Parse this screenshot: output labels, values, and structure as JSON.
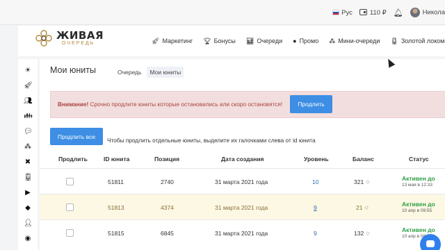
{
  "topbar": {
    "language": "Рус",
    "balance": "110 ₽",
    "username": "Никола"
  },
  "logo": {
    "line1": "ЖИВАЯ",
    "line2": "ОЧЕРЕДЬ"
  },
  "nav": {
    "items": [
      {
        "label": "Маркетинг",
        "icon": "rocket-icon"
      },
      {
        "label": "Бонусы",
        "icon": "trophy-icon"
      },
      {
        "label": "Очереди",
        "icon": "chart-icon"
      },
      {
        "label": "Промо",
        "icon": "bomb-icon"
      },
      {
        "label": "Мини-очереди",
        "icon": "sitemap-icon"
      },
      {
        "label": "Золотой локомоти",
        "icon": "train-icon"
      }
    ]
  },
  "sidebar": {
    "icons": [
      "sun-icon",
      "rocket-icon",
      "users-icon",
      "user-group-icon",
      "chat-icon",
      "sitemap-icon",
      "close-icon",
      "train-icon",
      "video-icon",
      "shield-icon",
      "user-icon",
      "globe-icon"
    ]
  },
  "page": {
    "title": "Мои юниты",
    "tabs": [
      "Очередь",
      "Мои юниты"
    ],
    "active_tab": "Мои юниты"
  },
  "alert": {
    "strong": "Внимание!",
    "text": " Срочно продлите юниты которые остановились или скоро остановятся!",
    "button": "Продлить"
  },
  "actions": {
    "prolong_all": "Продлить все",
    "hint": "Чтобы продлить отдельные юниты, выделите их галочками слева от id юнита"
  },
  "table": {
    "headers": [
      "Продлить",
      "ID юнита",
      "Позиция",
      "Дата создания",
      "Уровень",
      "Баланс",
      "Статус"
    ],
    "rows": [
      {
        "id": "51811",
        "position": "2740",
        "created": "31 марта 2021 года",
        "level": "10",
        "balance": "321",
        "status": "Активен до",
        "status_date": "13 мая в 12:33",
        "highlight": false
      },
      {
        "id": "51813",
        "position": "4374",
        "created": "31 марта 2021 года",
        "level": "9",
        "balance": "21",
        "status": "Активен до",
        "status_date": "10 апр в 09:55",
        "highlight": true
      },
      {
        "id": "51815",
        "position": "6845",
        "created": "31 марта 2021 года",
        "level": "9",
        "balance": "132",
        "status": "Активен до",
        "status_date": "10 апр в 08:23",
        "highlight": false
      }
    ]
  },
  "colors": {
    "primary": "#3d8ee4",
    "alert_bg": "#f2dede",
    "alert_text": "#a94442",
    "highlight_row": "#fcf8e3",
    "status_green": "#2f9e44"
  }
}
